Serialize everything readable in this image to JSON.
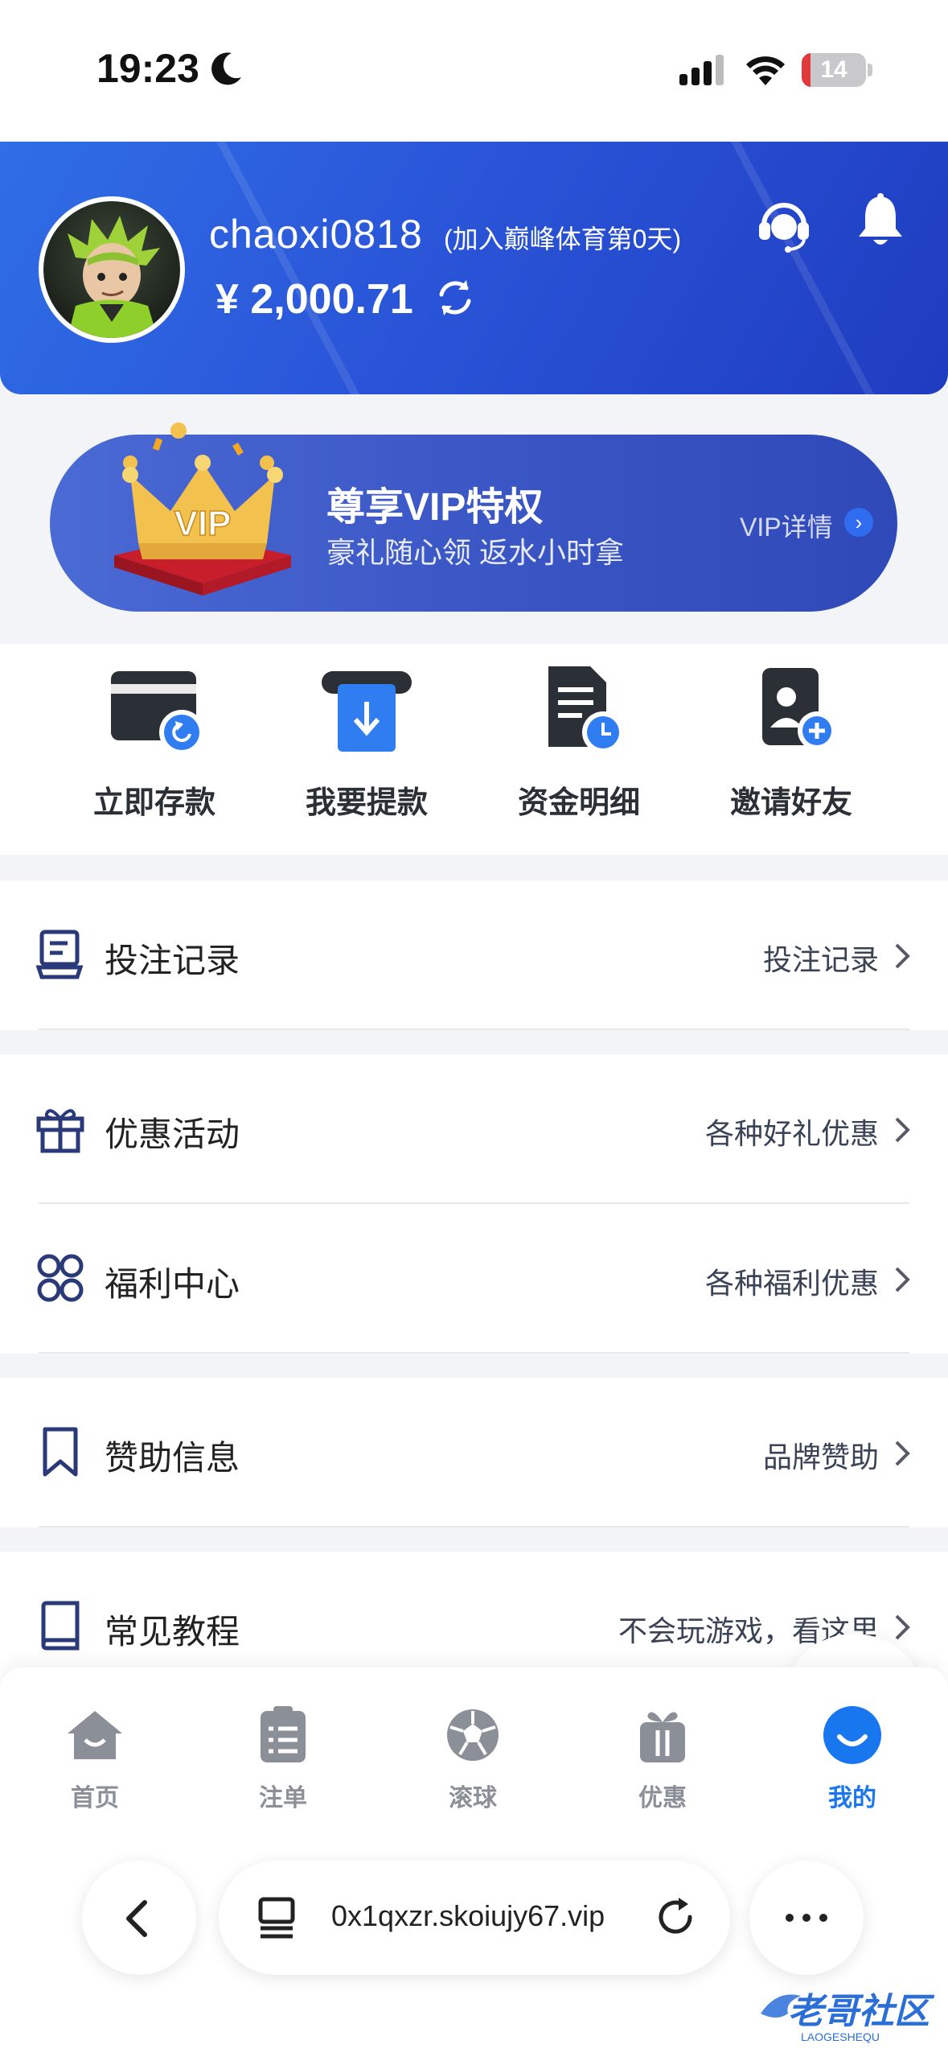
{
  "status_bar": {
    "time": "19:23",
    "battery": "14",
    "battery_fraction": 0.14
  },
  "header": {
    "username": "chaoxi0818",
    "join_note": "(加入巅峰体育第0天)",
    "balance": "¥ 2,000.71"
  },
  "vip": {
    "badge": "VIP",
    "title": "尊享VIP特权",
    "subtitle": "豪礼随心领 返水小时拿",
    "detail": "VIP详情"
  },
  "quick_actions": [
    {
      "label": "立即存款",
      "icon": "deposit-icon"
    },
    {
      "label": "我要提款",
      "icon": "withdraw-icon"
    },
    {
      "label": "资金明细",
      "icon": "statement-icon"
    },
    {
      "label": "邀请好友",
      "icon": "invite-icon"
    }
  ],
  "menu": {
    "bet_records": {
      "label": "投注记录",
      "value": "投注记录",
      "icon": "document-icon"
    },
    "promotions": {
      "label": "优惠活动",
      "value": "各种好礼优惠",
      "icon": "gift-icon"
    },
    "welfare": {
      "label": "福利中心",
      "value": "各种福利优惠",
      "icon": "grid-icon"
    },
    "sponsor": {
      "label": "赞助信息",
      "value": "品牌赞助",
      "icon": "bookmark-icon"
    },
    "tutorial": {
      "label": "常见教程",
      "value": "不会玩游戏，看这里",
      "icon": "book-icon"
    }
  },
  "tabs": [
    {
      "label": "首页",
      "icon": "home-icon"
    },
    {
      "label": "注单",
      "icon": "clipboard-icon"
    },
    {
      "label": "滚球",
      "icon": "soccer-ball-icon"
    },
    {
      "label": "优惠",
      "icon": "gift-icon"
    },
    {
      "label": "我的",
      "icon": "profile-icon",
      "active": true
    }
  ],
  "browser": {
    "url": "0x1qxzr.skoiujy67.vip"
  },
  "watermark": {
    "text": "老哥社区",
    "sub": "LAOGESHEQU"
  },
  "colors": {
    "brand_blue": "#2a55d8",
    "accent": "#1877ee",
    "battery_low": "#e2393b"
  }
}
